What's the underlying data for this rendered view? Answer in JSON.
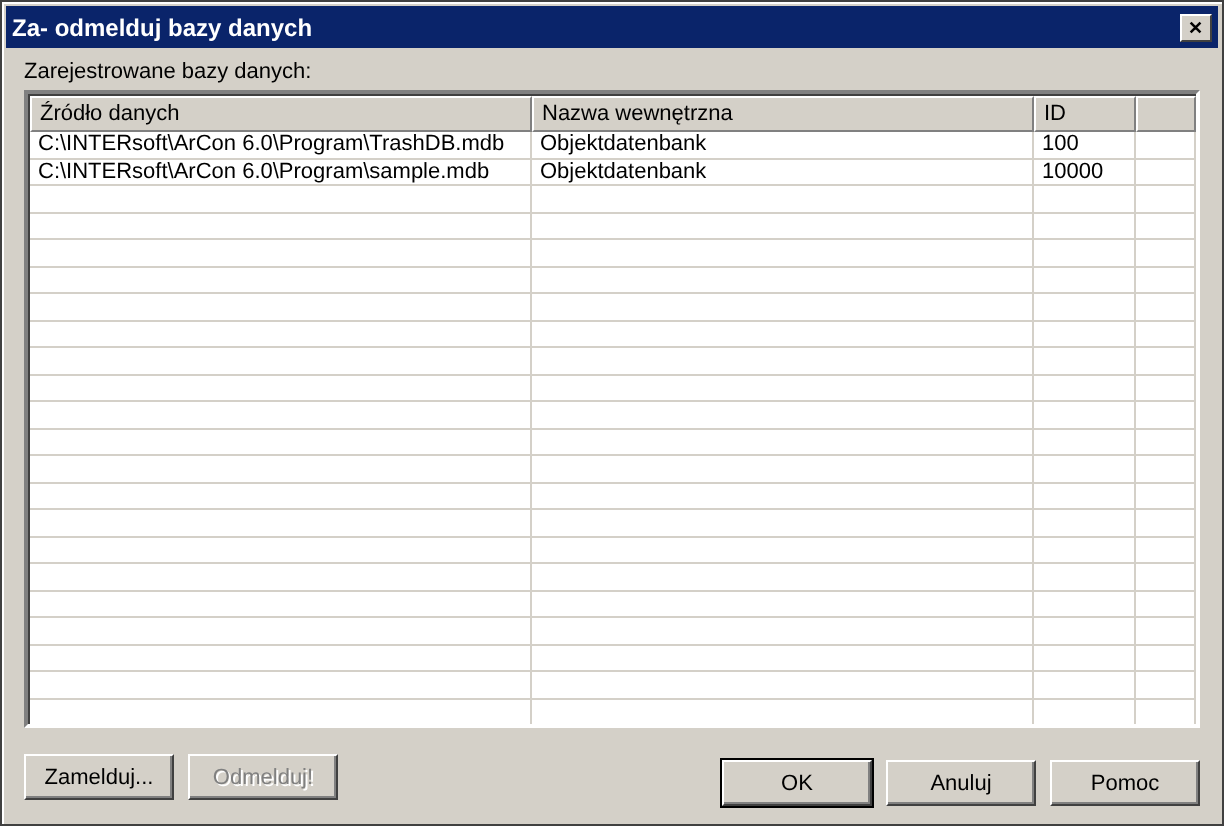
{
  "window": {
    "title": "Za- odmelduj bazy danych",
    "close": "✕"
  },
  "list_label": "Zarejestrowane bazy danych:",
  "table": {
    "columns": [
      "Źródło danych",
      "Nazwa wewnętrzna",
      "ID"
    ],
    "rows": [
      {
        "cells": [
          "C:\\INTERsoft\\ArCon 6.0\\Program\\TrashDB.mdb",
          "Objektdatenbank",
          "100"
        ]
      },
      {
        "cells": [
          "C:\\INTERsoft\\ArCon 6.0\\Program\\sample.mdb",
          "Objektdatenbank",
          "10000"
        ]
      }
    ]
  },
  "left_buttons": [
    {
      "label": "Zamelduj...",
      "disabled": false
    },
    {
      "label": "Odmelduj!",
      "disabled": true
    }
  ],
  "right_buttons": [
    {
      "label": "OK",
      "default": true
    },
    {
      "label": "Anuluj",
      "default": false
    },
    {
      "label": "Pomoc",
      "default": false
    }
  ]
}
